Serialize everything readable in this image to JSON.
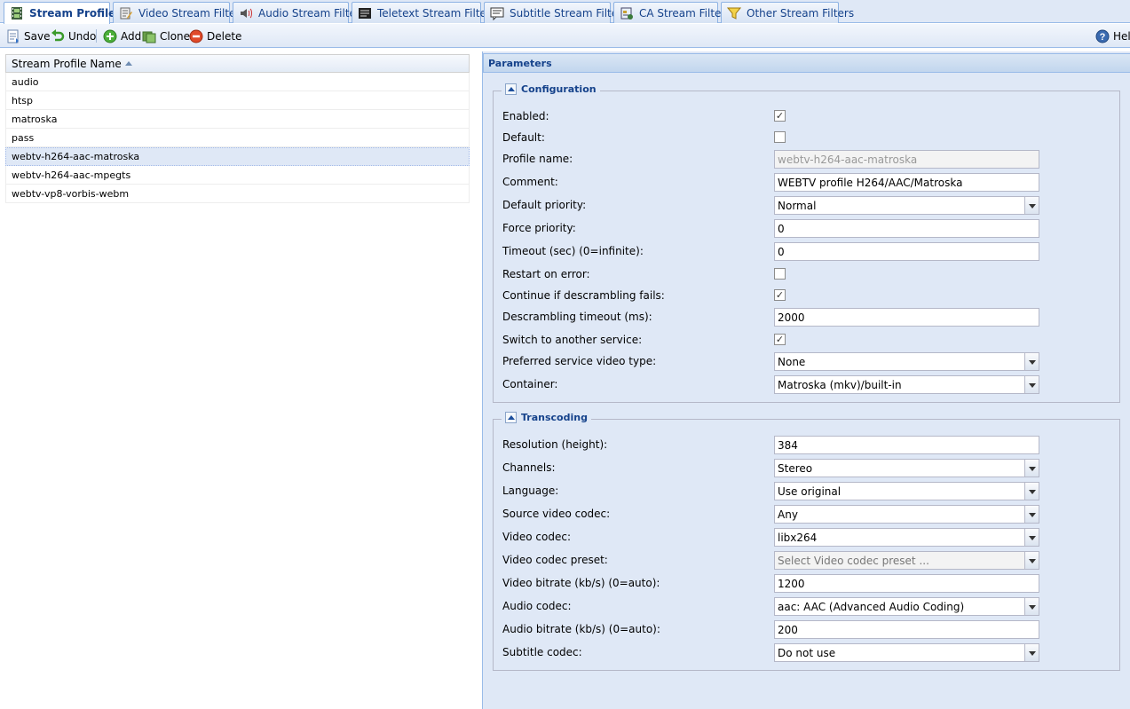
{
  "tabs": [
    {
      "label": "Stream Profiles",
      "active": true,
      "icon": "film-icon"
    },
    {
      "label": "Video Stream Filters",
      "active": false,
      "icon": "video-filter-icon"
    },
    {
      "label": "Audio Stream Filters",
      "active": false,
      "icon": "speaker-icon"
    },
    {
      "label": "Teletext Stream Filters",
      "active": false,
      "icon": "teletext-icon"
    },
    {
      "label": "Subtitle Stream Filters",
      "active": false,
      "icon": "subtitle-icon"
    },
    {
      "label": "CA Stream Filters",
      "active": false,
      "icon": "ca-card-icon"
    },
    {
      "label": "Other Stream Filters",
      "active": false,
      "icon": "funnel-icon"
    }
  ],
  "toolbar": {
    "save": "Save",
    "undo": "Undo",
    "add": "Add",
    "clone": "Clone",
    "delete": "Delete",
    "help": "Help"
  },
  "grid": {
    "column": "Stream Profile Name",
    "rows": [
      "audio",
      "htsp",
      "matroska",
      "pass",
      "webtv-h264-aac-matroska",
      "webtv-h264-aac-mpegts",
      "webtv-vp8-vorbis-webm"
    ],
    "selected_index": 4
  },
  "panel": {
    "title": "Parameters",
    "configuration": {
      "legend": "Configuration",
      "enabled": {
        "label": "Enabled:",
        "checked": true
      },
      "default": {
        "label": "Default:",
        "checked": false
      },
      "profile_name": {
        "label": "Profile name:",
        "value": "webtv-h264-aac-matroska"
      },
      "comment": {
        "label": "Comment:",
        "value": "WEBTV profile H264/AAC/Matroska"
      },
      "default_priority": {
        "label": "Default priority:",
        "value": "Normal"
      },
      "force_priority": {
        "label": "Force priority:",
        "value": "0"
      },
      "timeout": {
        "label": "Timeout (sec) (0=infinite):",
        "value": "0"
      },
      "restart_on_error": {
        "label": "Restart on error:",
        "checked": false
      },
      "continue_descrambling": {
        "label": "Continue if descrambling fails:",
        "checked": true
      },
      "descrambling_timeout": {
        "label": "Descrambling timeout (ms):",
        "value": "2000"
      },
      "switch_service": {
        "label": "Switch to another service:",
        "checked": true
      },
      "preferred_video_type": {
        "label": "Preferred service video type:",
        "value": "None"
      },
      "container": {
        "label": "Container:",
        "value": "Matroska (mkv)/built-in"
      }
    },
    "transcoding": {
      "legend": "Transcoding",
      "resolution": {
        "label": "Resolution (height):",
        "value": "384"
      },
      "channels": {
        "label": "Channels:",
        "value": "Stereo"
      },
      "language": {
        "label": "Language:",
        "value": "Use original"
      },
      "source_video_codec": {
        "label": "Source video codec:",
        "value": "Any"
      },
      "video_codec": {
        "label": "Video codec:",
        "value": "libx264"
      },
      "video_codec_preset": {
        "label": "Video codec preset:",
        "placeholder": "Select Video codec preset ..."
      },
      "video_bitrate": {
        "label": "Video bitrate (kb/s) (0=auto):",
        "value": "1200"
      },
      "audio_codec": {
        "label": "Audio codec:",
        "value": "aac: AAC (Advanced Audio Coding)"
      },
      "audio_bitrate": {
        "label": "Audio bitrate (kb/s) (0=auto):",
        "value": "200"
      },
      "subtitle_codec": {
        "label": "Subtitle codec:",
        "value": "Do not use"
      }
    }
  },
  "colors": {
    "header_text": "#15428b",
    "panel_bg": "#dfe8f6",
    "border": "#99bbe8",
    "selected_row": "#dfe8f6"
  }
}
